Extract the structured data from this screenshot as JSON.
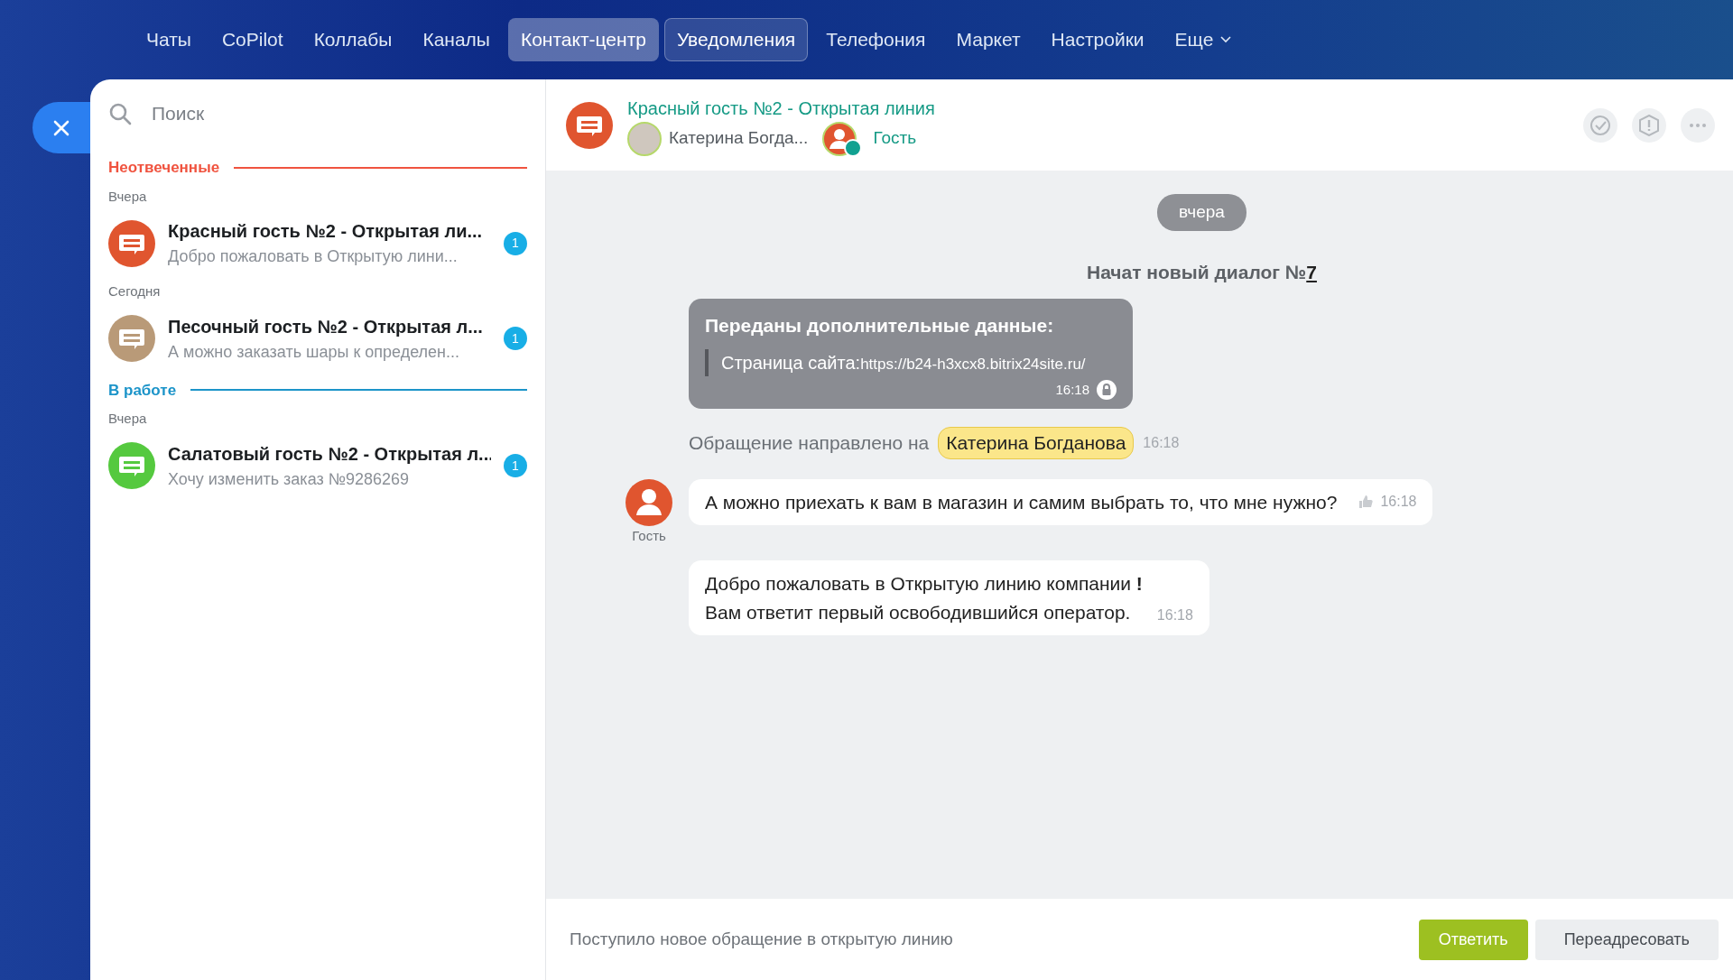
{
  "top_nav": [
    {
      "label": "Чаты",
      "selected": false,
      "hovered": false
    },
    {
      "label": "CoPilot",
      "selected": false,
      "hovered": false
    },
    {
      "label": "Коллабы",
      "selected": false,
      "hovered": false
    },
    {
      "label": "Каналы",
      "selected": false,
      "hovered": false
    },
    {
      "label": "Контакт-центр",
      "selected": true,
      "hovered": false
    },
    {
      "label": "Уведомления",
      "selected": false,
      "hovered": true
    },
    {
      "label": "Телефония",
      "selected": false,
      "hovered": false
    },
    {
      "label": "Маркет",
      "selected": false,
      "hovered": false
    },
    {
      "label": "Настройки",
      "selected": false,
      "hovered": false
    },
    {
      "label": "Еще",
      "selected": false,
      "hovered": false,
      "dropdown": true
    }
  ],
  "search": {
    "placeholder": "Поиск"
  },
  "sections": [
    {
      "title": "Неотвеченные",
      "color": "#f0533f",
      "groups": [
        {
          "date": "Вчера",
          "items": [
            {
              "title": "Красный гость №2 - Открытая ли...",
              "preview": "Добро пожаловать в Открытую лини...",
              "color": "#e0552f",
              "unread": "1",
              "selected": false
            }
          ]
        },
        {
          "date": "Сегодня",
          "items": [
            {
              "title": "Песочный гость №2 - Открытая л...",
              "preview": "А можно заказать шары к определен...",
              "color": "#b99a78",
              "unread": "1",
              "selected": false
            }
          ]
        }
      ]
    },
    {
      "title": "В работе",
      "color": "#1c94c9",
      "groups": [
        {
          "date": "Вчера",
          "items": [
            {
              "title": "Салатовый гость №2 - Открытая л...",
              "preview": "Хочу изменить заказ №9286269",
              "color": "#55c93f",
              "unread": "1",
              "selected": false
            }
          ]
        }
      ]
    }
  ],
  "chat_header": {
    "title": "Красный гость №2 - Открытая линия",
    "color": "#e0552f",
    "members": [
      {
        "name": "Катерина Богда...",
        "kind": "operator"
      },
      {
        "name": "Гость",
        "kind": "guest"
      }
    ]
  },
  "messages": [
    {
      "kind": "date",
      "text": "вчера"
    },
    {
      "kind": "system",
      "text": "Начат новый диалог №",
      "link": "7"
    },
    {
      "kind": "data",
      "title": "Переданы дополнительные данные:",
      "label": "Страница сайта:",
      "value": "https://b24-h3xcx8.bitrix24site.ru/",
      "time": "16:18"
    },
    {
      "kind": "notice",
      "text": "Обращение направлено на",
      "user": "Катерина Богданова",
      "time": "16:18"
    },
    {
      "kind": "incoming",
      "author": "Гость",
      "text": "А можно приехать к вам в магазин и самим выбрать то, что мне нужно?",
      "time": "16:18"
    },
    {
      "kind": "bot",
      "text": "Добро пожаловать в Открытую линию компании **!**\nВам ответит первый освободившийся оператор.",
      "time": "16:18"
    }
  ],
  "footer": {
    "text": "Поступило новое обращение в открытую линию",
    "buttons": [
      {
        "label": "Ответить",
        "kind": "primary"
      },
      {
        "label": "Переадресовать",
        "kind": "secondary"
      }
    ]
  }
}
